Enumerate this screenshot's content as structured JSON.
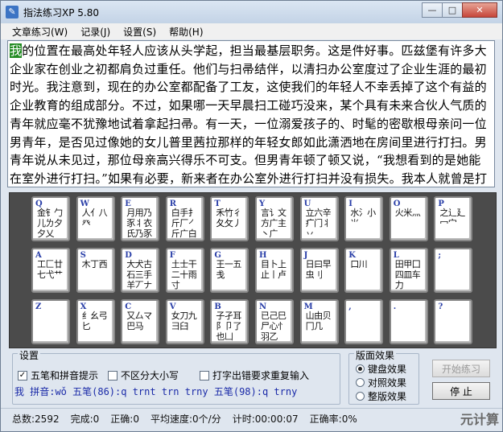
{
  "window": {
    "title": "指法练习XP 5.80",
    "icon": "app-icon",
    "minimize": "—",
    "maximize": "□",
    "close": "✕"
  },
  "menu": [
    "文章练习(W)",
    "记录(J)",
    "设置(S)",
    "帮助(H)"
  ],
  "text": {
    "current_char": "我",
    "rest": "的位置在最高处年轻人应该从头学起，担当最基层职务。这是件好事。匹兹堡有许多大企业家在创业之初都肩负过重任。他们与扫帚结伴，以清扫办公室度过了企业生涯的最初时光。我注意到，现在的办公室都配备了工友，这使我们的年轻人不幸丢掉了这个有益的企业教育的组成部分。不过，如果哪一天早晨扫工碰巧没来，某个具有未来合伙人气质的青年就应毫不犹豫地试着拿起扫帚。有一天，一位溺爱孩子的、时髦的密歇根母亲问一位男青年，是否见过像她的女儿普里茜拉那样的年轻女郎如此潇洒地在房间里进行打扫。男青年说从未见过，那位母亲高兴得乐不可支。但男青年顿了顿又说，“我想看到的是她能在室外进行打扫。”如果有必要，新来者在办公室外进行打扫并没有损失。我本人就曾是打扫人之一。假如你们都得到了聘用，而且都有"
  },
  "keyboard": {
    "rows": [
      [
        {
          "letter": "Q",
          "roots": "金钅勹儿ㄌ夕夕乂"
        },
        {
          "letter": "W",
          "roots": "人亻八癶"
        },
        {
          "letter": "E",
          "roots": "月用乃豕丬衣氏乃豕区"
        },
        {
          "letter": "R",
          "roots": "白手扌斤厂㇒斤广白"
        },
        {
          "letter": "T",
          "roots": "禾竹彳夂攵丿"
        },
        {
          "letter": "Y",
          "roots": "言讠文方广主丶广"
        },
        {
          "letter": "U",
          "roots": "立六辛疒门丬丷"
        },
        {
          "letter": "I",
          "roots": "水氵小⺌"
        },
        {
          "letter": "O",
          "roots": "火米灬"
        },
        {
          "letter": "P",
          "roots": "之辶廴冖宀"
        }
      ],
      [
        {
          "letter": "A",
          "roots": "工匚廿七弋艹"
        },
        {
          "letter": "S",
          "roots": "木丁西"
        },
        {
          "letter": "D",
          "roots": "大犬古石三手羊丆ナ"
        },
        {
          "letter": "F",
          "roots": "土士干二十雨寸"
        },
        {
          "letter": "G",
          "roots": "王一五戋"
        },
        {
          "letter": "H",
          "roots": "目卜上止丨卢"
        },
        {
          "letter": "J",
          "roots": "日曰早虫刂"
        },
        {
          "letter": "K",
          "roots": "口川"
        },
        {
          "letter": "L",
          "roots": "田甲囗四皿车力"
        },
        {
          "letter": ";",
          "roots": ""
        }
      ],
      [
        {
          "letter": "Z",
          "roots": ""
        },
        {
          "letter": "X",
          "roots": "纟幺弓匕"
        },
        {
          "letter": "C",
          "roots": "又厶マ巴马"
        },
        {
          "letter": "V",
          "roots": "女刀九彐臼"
        },
        {
          "letter": "B",
          "roots": "子孑耳阝卩了也凵"
        },
        {
          "letter": "N",
          "roots": "已己巳尸心忄羽乙"
        },
        {
          "letter": "M",
          "roots": "山由贝冂几"
        },
        {
          "letter": ",",
          "roots": ""
        },
        {
          "letter": ".",
          "roots": ""
        },
        {
          "letter": "?",
          "roots": ""
        }
      ]
    ]
  },
  "settings": {
    "title": "设置",
    "wubi_pinyin": {
      "label": "五笔和拼音提示",
      "checked": true
    },
    "case_insensitive": {
      "label": "不区分大小写",
      "checked": false
    },
    "retype_on_error": {
      "label": "打字出错要求重复输入",
      "checked": false
    },
    "hint_line": "我 拼音:wǒ 五笔(86):q trnt trn trny 五笔(98):q trny"
  },
  "view": {
    "title": "版面效果",
    "options": [
      "键盘效果",
      "对照效果",
      "整版效果"
    ],
    "selected": "键盘效果"
  },
  "buttons": {
    "start": "开始练习",
    "stop": "停 止"
  },
  "status": {
    "total": "总数:2592",
    "done": "完成:0",
    "correct": "正确:0",
    "speed": "平均速度:0个/分",
    "timer": "计时:00:00:07",
    "accuracy": "正确率:0%"
  },
  "watermark": "元计算"
}
